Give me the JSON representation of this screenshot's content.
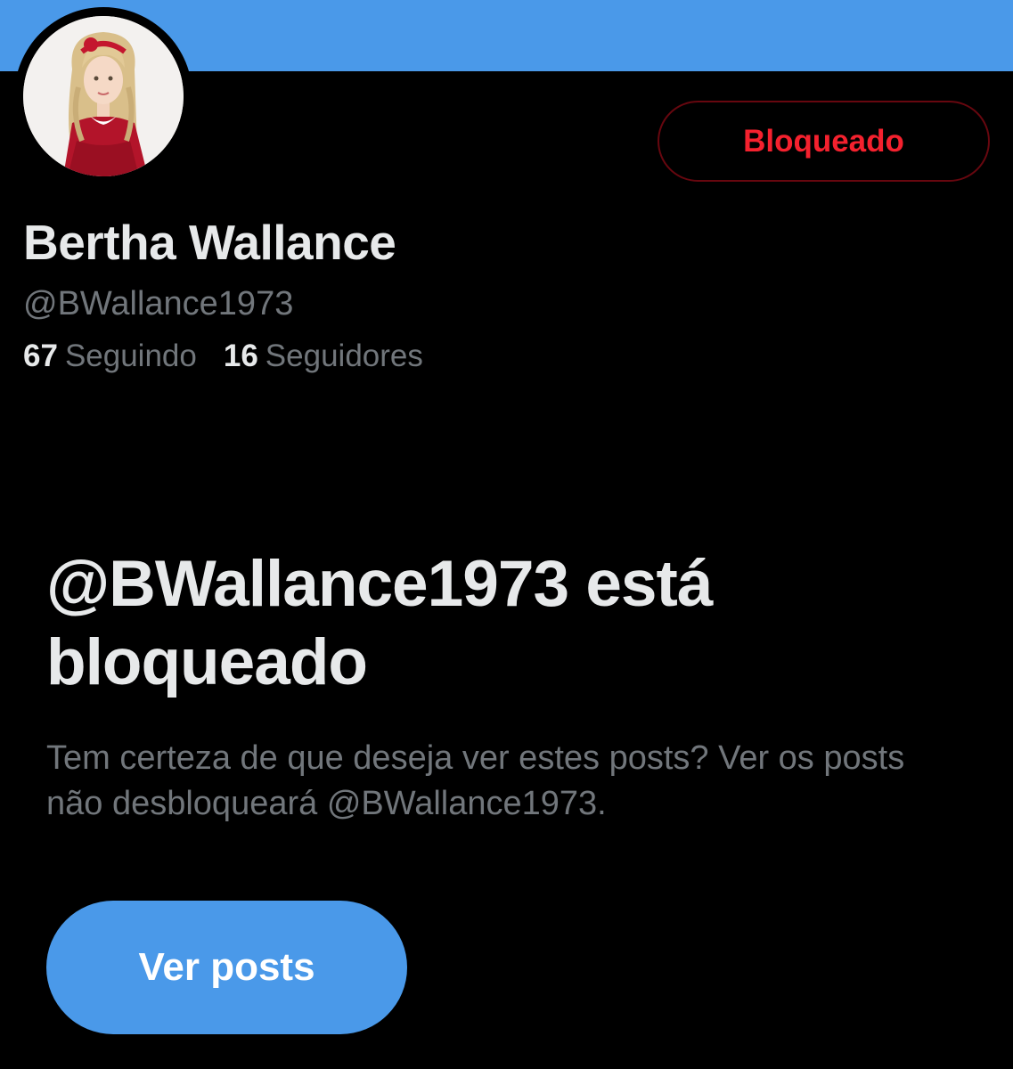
{
  "profile": {
    "display_name": "Bertha Wallance",
    "handle": "@BWallance1973",
    "block_button_label": "Bloqueado",
    "following_count": "67",
    "following_label": "Seguindo",
    "followers_count": "16",
    "followers_label": "Seguidores"
  },
  "blocked_notice": {
    "title": "@BWallance1973 está bloqueado",
    "description": "Tem certeza de que deseja ver estes posts? Ver os posts não desbloqueará @BWallance1973.",
    "view_posts_label": "Ver posts"
  },
  "colors": {
    "banner": "#4a99e9",
    "accent": "#4a99e9",
    "blocked_red": "#f4212e",
    "muted_text": "#71767b",
    "primary_text": "#e7e9ea"
  },
  "icons": {
    "avatar": "doll-avatar-image"
  }
}
